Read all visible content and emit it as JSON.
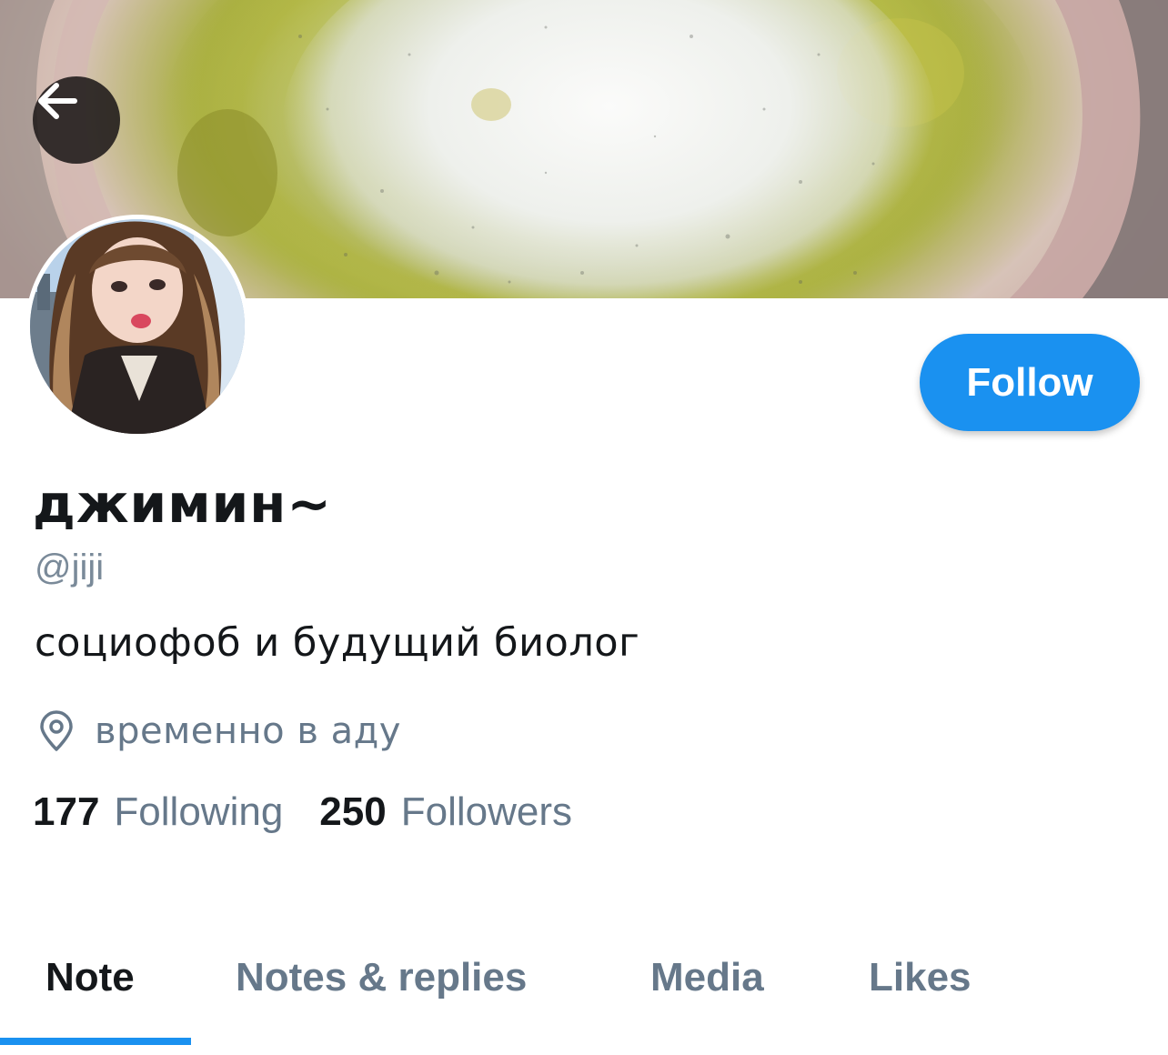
{
  "header": {
    "banner_icon": "matcha-latte-photo",
    "back_icon": "arrow-left-icon"
  },
  "profile": {
    "display_name": "джимин~",
    "handle": "@jiji",
    "bio": "социофоб и будущий биолог",
    "location_icon": "location-pin-icon",
    "location": "временно в аду",
    "follow_label": "Follow"
  },
  "stats": {
    "following_count": "177",
    "following_label": "Following",
    "followers_count": "250",
    "followers_label": "Followers"
  },
  "tabs": [
    {
      "label": "Note",
      "active": true
    },
    {
      "label": "Notes & replies",
      "active": false
    },
    {
      "label": "Media",
      "active": false
    },
    {
      "label": "Likes",
      "active": false
    }
  ],
  "colors": {
    "accent": "#1a91f0",
    "text_primary": "#14171a",
    "text_secondary": "#66788a"
  }
}
